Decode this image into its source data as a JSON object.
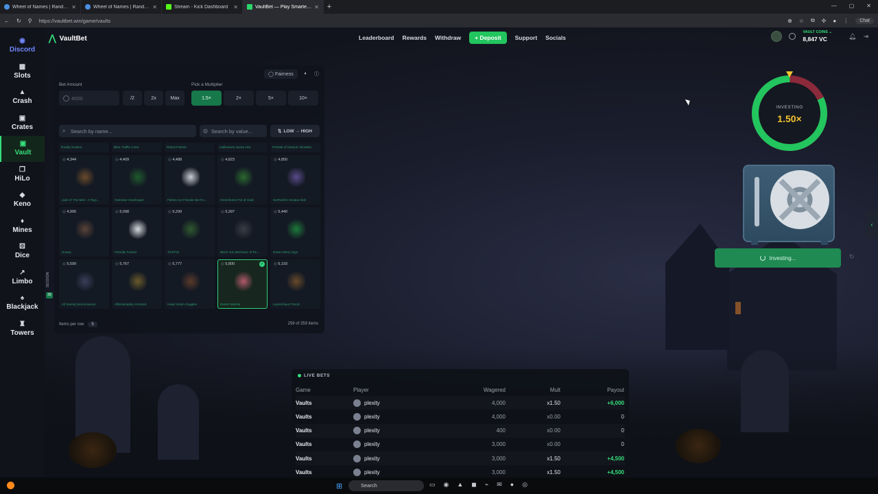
{
  "browser": {
    "tabs": [
      {
        "title": "Wheel of Names | Random name",
        "active": false
      },
      {
        "title": "Wheel of Names | Random name",
        "active": false
      },
      {
        "title": "Stream - Kick Dashboard",
        "active": false
      },
      {
        "title": "VaultBet — Play Smarter, Bet",
        "active": true
      }
    ],
    "url": "https://vaultbet.win/game/vaults",
    "chat_label": "Chat"
  },
  "sidebar": {
    "items": [
      {
        "label": "Discord",
        "icon": "discord-icon"
      },
      {
        "label": "Slots",
        "icon": "slots-icon"
      },
      {
        "label": "Crash",
        "icon": "rocket-icon"
      },
      {
        "label": "Crates",
        "icon": "crate-icon"
      },
      {
        "label": "Vault",
        "icon": "vault-icon"
      },
      {
        "label": "HiLo",
        "icon": "cards-icon"
      },
      {
        "label": "Keno",
        "icon": "keno-icon"
      },
      {
        "label": "Mines",
        "icon": "gem-icon"
      },
      {
        "label": "Dice",
        "icon": "dice-icon"
      },
      {
        "label": "Limbo",
        "icon": "chart-icon"
      },
      {
        "label": "Blackjack",
        "icon": "blackjack-icon"
      },
      {
        "label": "Towers",
        "icon": "tower-icon"
      }
    ],
    "active": "Vault"
  },
  "header": {
    "brand": "VaultBet",
    "nav": [
      "Leaderboard",
      "Rewards",
      "Withdraw"
    ],
    "deposit_label": "+ Deposit",
    "nav_after": [
      "Support",
      "Socials"
    ],
    "coins_label": "VAULT COINS ⌄",
    "coins_value": "8,847 VC"
  },
  "controls": {
    "fairness_label": "Fairness",
    "bet_amount_label": "Bet Amount",
    "bet_amount_placeholder": "4000",
    "half_label": "/2",
    "double_label": "2x",
    "max_label": "Max",
    "multiplier_label": "Pick a Multiplier",
    "multipliers": [
      "1.5×",
      "2×",
      "5×",
      "10×"
    ],
    "selected_multiplier": "1.5×",
    "search_name_placeholder": "Search by name...",
    "search_value_placeholder": "Search by value...",
    "sort_label": "LOW → HIGH",
    "items_per_row_label": "Items per row",
    "items_per_row": "5",
    "items_count": "259 of 259 items",
    "session_label": "SESSION",
    "session_count": "26"
  },
  "top_row_names": [
    "Ruddy Kraken",
    "Blue Traffic Cone",
    "Robot Patrick",
    "Halloween Santa Hat",
    "Portrait of Genius: Einstein"
  ],
  "items": [
    {
      "value": "4,344",
      "name": "Jack O' The Mist - A Tarp...",
      "color": "#6b4a2a"
    },
    {
      "value": "4,409",
      "name": "Overseer Overlooper",
      "color": "#1f5a2c"
    },
    {
      "value": "4,488",
      "name": "Fishes Are Friends Not Fo...",
      "color": "#c9ccd4"
    },
    {
      "value": "4,823",
      "name": "Greenhorns Pot of Gold",
      "color": "#2a6a2f"
    },
    {
      "value": "4,850",
      "name": "NotToofn's Voodoo Doll",
      "color": "#5a4a8a"
    },
    {
      "value": "4,995",
      "name": "Snowy",
      "color": "#5a4438"
    },
    {
      "value": "5,098",
      "name": "Friendly Fedora",
      "color": "#d7dadf"
    },
    {
      "value": "5,299",
      "name": "Troll Pet",
      "color": "#2f5a2f"
    },
    {
      "value": "5,397",
      "name": "Black Iron Mechanic of Pe...",
      "color": "#3a3d45"
    },
    {
      "value": "5,440",
      "name": "Green Merry Sign",
      "color": "#1d7a3a"
    },
    {
      "value": "5,599",
      "name": "All Seeing Necromancer",
      "color": "#3a3f5a"
    },
    {
      "value": "5,767",
      "name": "Affectionately Armored",
      "color": "#6a5a2a"
    },
    {
      "value": "5,777",
      "name": "Head Vision Goggles",
      "color": "#5a3a2a"
    },
    {
      "value": "5,800",
      "name": "Desert Warrior",
      "color": "#b05a6a",
      "selected": true
    },
    {
      "value": "6,193",
      "name": "Leprechaun Friend",
      "color": "#6a4a2a"
    }
  ],
  "vault": {
    "status_label": "INVESTING",
    "multiplier": "1.50×",
    "progress_fraction": 0.82,
    "button_label": "Investing...",
    "ring_color": "#22c55e",
    "ring_remaining_color": "#8a2a3a"
  },
  "live_bets": {
    "title": "LIVE BETS",
    "columns": [
      "Game",
      "Player",
      "Wagered",
      "Mult",
      "Payout"
    ],
    "rows": [
      {
        "game": "Vaults",
        "player": "plexity",
        "wagered": "4,000",
        "mult": "x1.50",
        "payout": "+6,000",
        "win": true
      },
      {
        "game": "Vaults",
        "player": "plexity",
        "wagered": "4,000",
        "mult": "x0.00",
        "payout": "0",
        "win": false
      },
      {
        "game": "Vaults",
        "player": "plexity",
        "wagered": "400",
        "mult": "x0.00",
        "payout": "0",
        "win": false
      },
      {
        "game": "Vaults",
        "player": "plexity",
        "wagered": "3,000",
        "mult": "x0.00",
        "payout": "0",
        "win": false
      },
      {
        "game": "Vaults",
        "player": "plexity",
        "wagered": "3,000",
        "mult": "x1.50",
        "payout": "+4,500",
        "win": true
      },
      {
        "game": "Vaults",
        "player": "plexity",
        "wagered": "3,000",
        "mult": "x1.50",
        "payout": "+4,500",
        "win": true
      }
    ]
  },
  "taskbar": {
    "search_placeholder": "Search"
  }
}
